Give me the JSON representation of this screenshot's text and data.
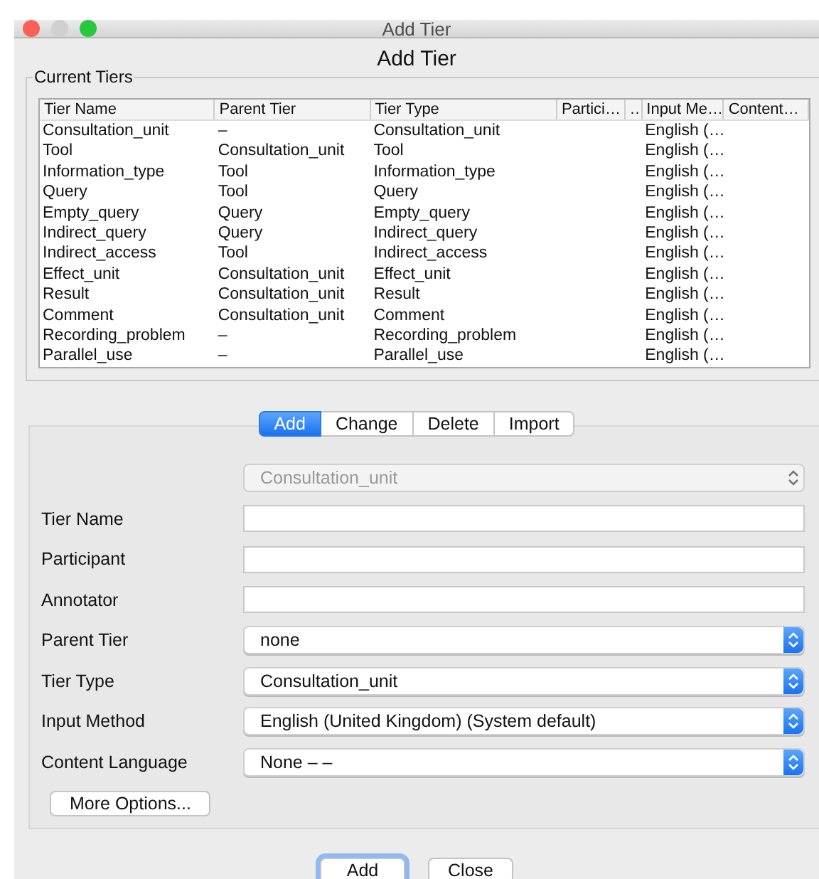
{
  "window": {
    "title": "Add Tier"
  },
  "heading": "Add Tier",
  "current_tiers": {
    "title": "Current Tiers",
    "columns": [
      "Tier Name",
      "Parent Tier",
      "Tier Type",
      "Partici…",
      "…",
      "Input Me…",
      "Content…"
    ],
    "rows": [
      [
        "Consultation_unit",
        "–",
        "Consultation_unit",
        "",
        "",
        "English (…",
        ""
      ],
      [
        "Tool",
        "Consultation_unit",
        "Tool",
        "",
        "",
        "English (…",
        ""
      ],
      [
        "Information_type",
        "Tool",
        "Information_type",
        "",
        "",
        "English (…",
        ""
      ],
      [
        "Query",
        "Tool",
        "Query",
        "",
        "",
        "English (…",
        ""
      ],
      [
        "Empty_query",
        "Query",
        "Empty_query",
        "",
        "",
        "English (…",
        ""
      ],
      [
        "Indirect_query",
        "Query",
        "Indirect_query",
        "",
        "",
        "English (…",
        ""
      ],
      [
        "Indirect_access",
        "Tool",
        "Indirect_access",
        "",
        "",
        "English (…",
        ""
      ],
      [
        "Effect_unit",
        "Consultation_unit",
        "Effect_unit",
        "",
        "",
        "English (…",
        ""
      ],
      [
        "Result",
        "Consultation_unit",
        "Result",
        "",
        "",
        "English (…",
        ""
      ],
      [
        "Comment",
        "Consultation_unit",
        "Comment",
        "",
        "",
        "English (…",
        ""
      ],
      [
        "Recording_problem",
        "–",
        "Recording_problem",
        "",
        "",
        "English (…",
        ""
      ],
      [
        "Parallel_use",
        "–",
        "Parallel_use",
        "",
        "",
        "English (…",
        ""
      ]
    ]
  },
  "tabs": [
    {
      "label": "Add",
      "selected": true
    },
    {
      "label": "Change",
      "selected": false
    },
    {
      "label": "Delete",
      "selected": false
    },
    {
      "label": "Import",
      "selected": false
    }
  ],
  "form": {
    "fields": [
      {
        "kind": "select",
        "value": "Consultation_unit",
        "disabled": true
      },
      {
        "kind": "text",
        "label": "Tier Name"
      },
      {
        "kind": "text",
        "label": "Participant"
      },
      {
        "kind": "text",
        "label": "Annotator"
      },
      {
        "kind": "select",
        "label": "Parent Tier",
        "value": "none",
        "disabled": false
      },
      {
        "kind": "select",
        "label": "Tier Type",
        "value": "Consultation_unit",
        "disabled": false
      },
      {
        "kind": "select",
        "label": "Input Method",
        "value": "English (United Kingdom) (System default)",
        "disabled": false
      },
      {
        "kind": "select",
        "label": "Content Language",
        "value": "None –  –",
        "disabled": false
      }
    ],
    "more_button": "More Options..."
  },
  "buttons": [
    {
      "label": "Add",
      "default": true
    },
    {
      "label": "Close",
      "default": false
    }
  ]
}
